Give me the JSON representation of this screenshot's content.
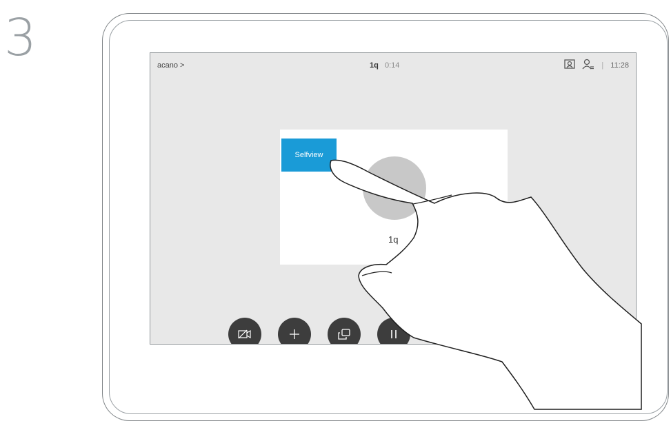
{
  "step_number": "3",
  "topbar": {
    "breadcrumb": "acano >",
    "call_name": "1q",
    "call_time": "0:14",
    "separator": "|",
    "clock": "11:28",
    "icons": [
      "selfview-icon",
      "person-icon"
    ]
  },
  "tile": {
    "selfview_label": "Selfview",
    "participant_name": "1q"
  },
  "controls": {
    "icons": [
      "camera-off-icon",
      "add-icon",
      "selfview-toggle-icon",
      "hold-icon"
    ]
  },
  "bottom_controls": {
    "icons": [
      "volume-icon",
      "mute-microphone-icon"
    ]
  },
  "colors": {
    "accent": "#1a9bd7",
    "control_bg": "#3d3d3d",
    "screen_bg": "#e8e8e8"
  }
}
